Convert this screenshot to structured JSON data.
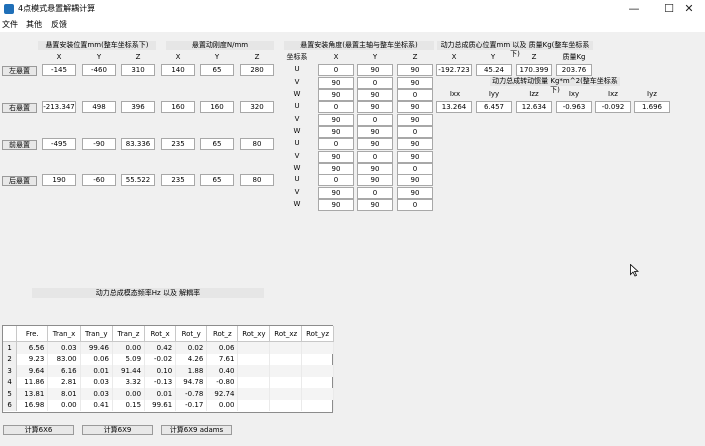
{
  "window": {
    "title": "4点模式悬置解耦计算",
    "controls": {
      "minimize": "—",
      "maximize": "☐",
      "close": "✕"
    }
  },
  "menu": [
    "文件",
    "其他",
    "反馈"
  ],
  "headers": {
    "position": "悬置安装位置mm(整车坐标系下)",
    "stiffness": "悬置动刚度N/mm",
    "angle": "悬置安装角度(悬置主轴与整车坐标系)",
    "centroid": "动力总成质心位置mm 以及 质量Kg(整车坐标系下)",
    "inertia": "动力总成转动惯量 Kg*m^2(整车坐标系下)",
    "freq_title": "动力总成模态频率Hz 以及 解耦率"
  },
  "col_labels": {
    "xyz": [
      "X",
      "Y",
      "Z"
    ],
    "angle_xyz": [
      "X",
      "Y",
      "Z"
    ],
    "coord_sys": "坐标系",
    "uvw": [
      "U",
      "V",
      "W"
    ],
    "mass": "质量Kg",
    "inertia": [
      "Ixx",
      "Iyy",
      "Izz",
      "Ixy",
      "Ixz",
      "Iyz"
    ]
  },
  "mounts": [
    {
      "name": "左悬置",
      "pos": [
        "-145",
        "-460",
        "310"
      ],
      "stiff": [
        "140",
        "65",
        "280"
      ],
      "angles": [
        [
          "0",
          "90",
          "90"
        ],
        [
          "90",
          "0",
          "90"
        ],
        [
          "90",
          "90",
          "0"
        ]
      ]
    },
    {
      "name": "右悬置",
      "pos": [
        "-213.347",
        "498",
        "396"
      ],
      "stiff": [
        "160",
        "160",
        "320"
      ],
      "angles": [
        [
          "0",
          "90",
          "90"
        ],
        [
          "90",
          "0",
          "90"
        ],
        [
          "90",
          "90",
          "0"
        ]
      ]
    },
    {
      "name": "前悬置",
      "pos": [
        "-495",
        "-90",
        "83.336"
      ],
      "stiff": [
        "235",
        "65",
        "80"
      ],
      "angles": [
        [
          "0",
          "90",
          "90"
        ],
        [
          "90",
          "0",
          "90"
        ],
        [
          "90",
          "90",
          "0"
        ]
      ]
    },
    {
      "name": "后悬置",
      "pos": [
        "190",
        "-60",
        "55.522"
      ],
      "stiff": [
        "235",
        "65",
        "80"
      ],
      "angles": [
        [
          "0",
          "90",
          "90"
        ],
        [
          "90",
          "0",
          "90"
        ],
        [
          "90",
          "90",
          "0"
        ]
      ]
    }
  ],
  "centroid": [
    "-192.723",
    "45.24",
    "170.399"
  ],
  "mass": "203.76",
  "inertia": [
    "13.264",
    "6.457",
    "12.634",
    "-0.963",
    "-0.092",
    "1.696"
  ],
  "results": {
    "columns": [
      "Fre.",
      "Tran_x",
      "Tran_y",
      "Tran_z",
      "Rot_x",
      "Rot_y",
      "Rot_z",
      "Rot_xy",
      "Rot_xz",
      "Rot_yz"
    ],
    "rows": [
      {
        "id": "1",
        "cells": [
          "6.56",
          "0.03",
          "99.46",
          "0.00",
          "0.42",
          "0.02",
          "0.06",
          "",
          "",
          ""
        ]
      },
      {
        "id": "2",
        "cells": [
          "9.23",
          "83.00",
          "0.06",
          "5.09",
          "-0.02",
          "4.26",
          "7.61",
          "",
          "",
          ""
        ]
      },
      {
        "id": "3",
        "cells": [
          "9.64",
          "6.16",
          "0.01",
          "91.44",
          "0.10",
          "1.88",
          "0.40",
          "",
          "",
          ""
        ]
      },
      {
        "id": "4",
        "cells": [
          "11.86",
          "2.81",
          "0.03",
          "3.32",
          "-0.13",
          "94.78",
          "-0.80",
          "",
          "",
          ""
        ]
      },
      {
        "id": "5",
        "cells": [
          "13.81",
          "8.01",
          "0.03",
          "0.00",
          "0.01",
          "-0.78",
          "92.74",
          "",
          "",
          ""
        ]
      },
      {
        "id": "6",
        "cells": [
          "16.98",
          "0.00",
          "0.41",
          "0.15",
          "99.61",
          "-0.17",
          "0.00",
          "",
          "",
          ""
        ]
      }
    ]
  },
  "buttons": {
    "calc6": "计算6X6",
    "calc9": "计算6X9",
    "calc9adams": "计算6X9 adams"
  },
  "cursor_icon": "arrow-cursor"
}
